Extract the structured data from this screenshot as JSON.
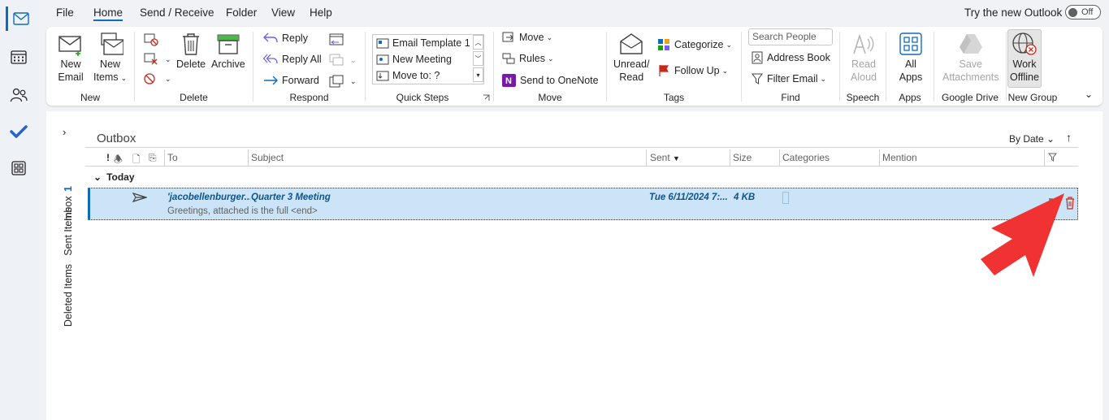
{
  "menubar": {
    "items": [
      "File",
      "Home",
      "Send / Receive",
      "Folder",
      "View",
      "Help"
    ],
    "active": "Home",
    "try_new": "Try the new Outlook",
    "toggle_label": "Off"
  },
  "ribbon": {
    "new_group": {
      "label": "New",
      "new_email": "New Email",
      "new_email_l1": "New",
      "new_email_l2": "Email",
      "new_items_l1": "New",
      "new_items_l2": "Items"
    },
    "delete_group": {
      "label": "Delete",
      "delete": "Delete",
      "archive": "Archive"
    },
    "respond_group": {
      "label": "Respond",
      "reply": "Reply",
      "reply_all": "Reply All",
      "forward": "Forward"
    },
    "quick_steps": {
      "label": "Quick Steps",
      "items": [
        "Email Template 1",
        "New Meeting",
        "Move to: ?"
      ]
    },
    "move_group": {
      "label": "Move",
      "move": "Move",
      "rules": "Rules",
      "onenote": "Send to OneNote"
    },
    "tags_group": {
      "label": "Tags",
      "unread_l1": "Unread/",
      "unread_l2": "Read",
      "categorize": "Categorize",
      "follow_up": "Follow Up"
    },
    "find_group": {
      "label": "Find",
      "search_placeholder": "Search People",
      "address_book": "Address Book",
      "filter_email": "Filter Email"
    },
    "speech_group": {
      "label": "Speech",
      "read_l1": "Read",
      "read_l2": "Aloud"
    },
    "apps_group": {
      "label": "Apps",
      "all_l1": "All",
      "all_l2": "Apps"
    },
    "gdrive_group": {
      "label": "Google Drive",
      "save_l1": "Save",
      "save_l2": "Attachments"
    },
    "new_group2": {
      "label": "New Group",
      "work_l1": "Work",
      "work_l2": "Offline"
    }
  },
  "folder_tabs": {
    "inbox": "Inbox",
    "inbox_count": "1",
    "sent": "Sent Items",
    "deleted": "Deleted Items"
  },
  "list": {
    "folder": "Outbox",
    "sort": "By Date",
    "columns": {
      "to": "To",
      "subject": "Subject",
      "sent": "Sent",
      "size": "Size",
      "categories": "Categories",
      "mention": "Mention"
    },
    "group": "Today",
    "message": {
      "to": "'jacobellenburger...",
      "subject": "Quarter 3 Meeting",
      "sent": "Tue 6/11/2024 7:...",
      "size": "4 KB",
      "preview": "Greetings, attached is the full <end>"
    }
  },
  "colors": {
    "accent": "#0f6cbd",
    "selected_row": "#cce4f7",
    "arrow": "#f03232"
  }
}
